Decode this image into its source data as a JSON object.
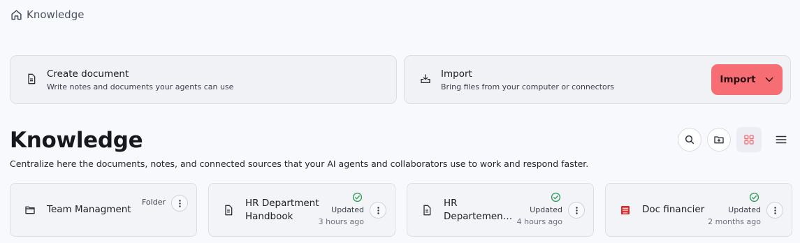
{
  "breadcrumb": {
    "label": "Knowledge"
  },
  "actions": {
    "create": {
      "title": "Create document",
      "subtitle": "Write notes and documents your agents can use"
    },
    "import": {
      "title": "Import",
      "subtitle": "Bring files from your computer or connectors",
      "button_label": "Import"
    }
  },
  "header": {
    "title": "Knowledge",
    "description": "Centralize here the documents, notes, and connected sources that your AI agents and collaborators use to work and respond faster."
  },
  "items": [
    {
      "name": "Team Managment",
      "kind": "Folder",
      "icon": "folder-icon"
    },
    {
      "name_line1": "HR Department",
      "name_line2": "Handbook",
      "status": "Updated",
      "time": "3 hours ago",
      "icon": "document-icon"
    },
    {
      "name_line1": "HR",
      "name_line2": "Departemen…",
      "status": "Updated",
      "time": "4 hours ago",
      "icon": "document-icon"
    },
    {
      "name": "Doc financier",
      "status": "Updated",
      "time": "2 months ago",
      "icon": "pdf-icon"
    }
  ],
  "colors": {
    "accent": "#f76d74",
    "success": "#2e9e5b",
    "pdf": "#d92b2b",
    "background": "#f8f9fc"
  }
}
